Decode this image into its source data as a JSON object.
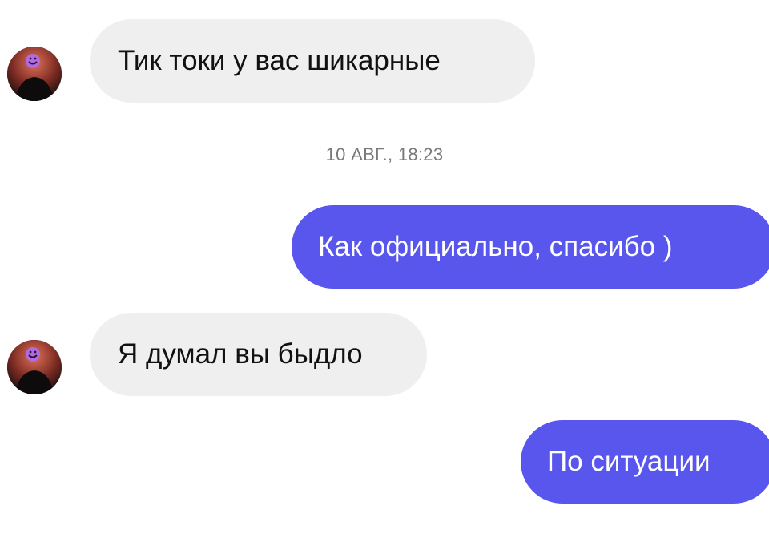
{
  "conversation": {
    "messages": [
      {
        "sender": "contact",
        "text": "Тик токи у вас шикарные"
      },
      {
        "sender": "me",
        "text": "Как официально, спасибо )"
      },
      {
        "sender": "contact",
        "text": "Я думал вы быдло"
      },
      {
        "sender": "me",
        "text": "По ситуации"
      }
    ],
    "timestamp": "10 АВГ., 18:23"
  },
  "colors": {
    "outgoing_bubble": "#5856ec",
    "incoming_bubble": "#efefef",
    "timestamp_text": "#7a7a7a"
  },
  "icons": {
    "avatar": "contact-avatar-icon"
  }
}
